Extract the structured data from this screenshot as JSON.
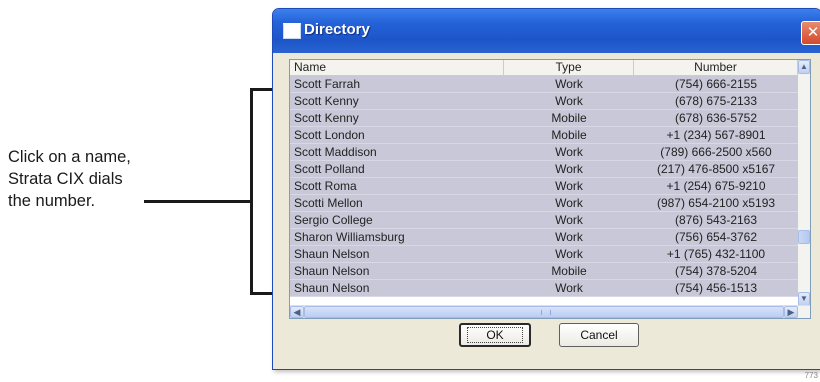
{
  "callout": {
    "lines": [
      "Click on a name,",
      "Strata CIX dials",
      "the number."
    ]
  },
  "window": {
    "title": "Directory",
    "close_glyph": "✕"
  },
  "list": {
    "columns": {
      "name": "Name",
      "type": "Type",
      "number": "Number"
    },
    "rows": [
      {
        "name": "Scott Farrah",
        "type": "Work",
        "number": "(754) 666-2155"
      },
      {
        "name": "Scott Kenny",
        "type": "Work",
        "number": "(678) 675-2133"
      },
      {
        "name": "Scott Kenny",
        "type": "Mobile",
        "number": "(678) 636-5752"
      },
      {
        "name": "Scott London",
        "type": "Mobile",
        "number": "+1 (234) 567-8901"
      },
      {
        "name": "Scott Maddison",
        "type": "Work",
        "number": "(789) 666-2500 x560"
      },
      {
        "name": "Scott Polland",
        "type": "Work",
        "number": "(217) 476-8500 x5167"
      },
      {
        "name": "Scott Roma",
        "type": "Work",
        "number": "+1 (254) 675-9210"
      },
      {
        "name": "Scotti Mellon",
        "type": "Work",
        "number": "(987) 654-2100 x5193"
      },
      {
        "name": "Sergio College",
        "type": "Work",
        "number": "(876) 543-2163"
      },
      {
        "name": "Sharon Williamsburg",
        "type": "Work",
        "number": "(756) 654-3762"
      },
      {
        "name": "Shaun Nelson",
        "type": "Work",
        "number": "+1 (765) 432-1100"
      },
      {
        "name": "Shaun Nelson",
        "type": "Mobile",
        "number": "(754) 378-5204"
      },
      {
        "name": "Shaun Nelson",
        "type": "Work",
        "number": "(754) 456-1513"
      }
    ]
  },
  "buttons": {
    "ok": "OK",
    "cancel": "Cancel"
  },
  "figure_code": "773",
  "colors": {
    "titlebar": "#2563d8",
    "row_selected": "#c8c8d8",
    "close": "#d5482a"
  },
  "icons": {
    "scroll_up": "▲",
    "scroll_down": "▼",
    "scroll_left": "◀",
    "scroll_right": "▶"
  }
}
